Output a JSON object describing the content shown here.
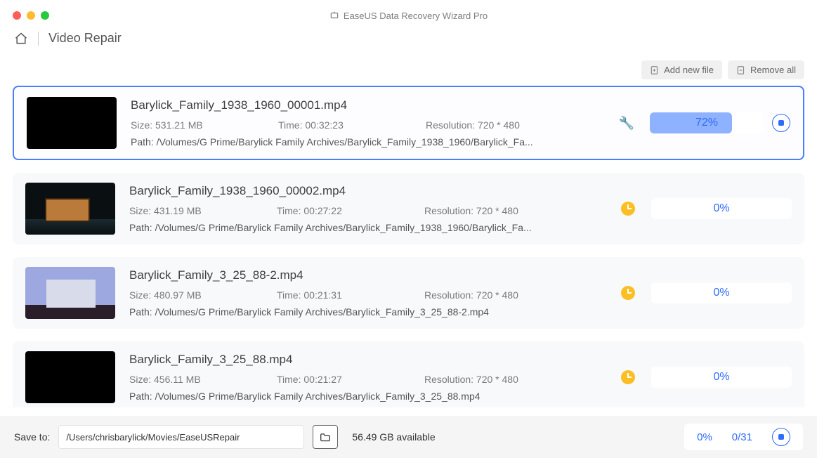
{
  "window": {
    "title": "EaseUS Data Recovery Wizard  Pro"
  },
  "breadcrumb": {
    "section": "Video Repair"
  },
  "toolbar": {
    "add_label": "Add new file",
    "remove_label": "Remove all"
  },
  "items": [
    {
      "name": "Barylick_Family_1938_1960_00001.mp4",
      "size": "Size: 531.21 MB",
      "time": "Time: 00:32:23",
      "resolution": "Resolution: 720 * 480",
      "path": "Path: /Volumes/G Prime/Barylick Family Archives/Barylick_Family_1938_1960/Barylick_Fa...",
      "status": "repairing",
      "percent": "72%",
      "percent_num": 72,
      "thumb_class": "black"
    },
    {
      "name": "Barylick_Family_1938_1960_00002.mp4",
      "size": "Size: 431.19 MB",
      "time": "Time: 00:27:22",
      "resolution": "Resolution: 720 * 480",
      "path": "Path: /Volumes/G Prime/Barylick Family Archives/Barylick_Family_1938_1960/Barylick_Fa...",
      "status": "pending",
      "percent": "0%",
      "percent_num": 0,
      "thumb_class": "cabin"
    },
    {
      "name": "Barylick_Family_3_25_88-2.mp4",
      "size": "Size: 480.97 MB",
      "time": "Time: 00:21:31",
      "resolution": "Resolution: 720 * 480",
      "path": "Path: /Volumes/G Prime/Barylick Family Archives/Barylick_Family_3_25_88-2.mp4",
      "status": "pending",
      "percent": "0%",
      "percent_num": 0,
      "thumb_class": "house"
    },
    {
      "name": "Barylick_Family_3_25_88.mp4",
      "size": "Size: 456.11 MB",
      "time": "Time: 00:21:27",
      "resolution": "Resolution: 720 * 480",
      "path": "Path: /Volumes/G Prime/Barylick Family Archives/Barylick_Family_3_25_88.mp4",
      "status": "pending",
      "percent": "0%",
      "percent_num": 0,
      "thumb_class": "black"
    }
  ],
  "footer": {
    "save_label": "Save to:",
    "save_path": "/Users/chrisbarylick/Movies/EaseUSRepair",
    "available": "56.49 GB available",
    "total_pct": "0%",
    "counter": "0/31"
  }
}
